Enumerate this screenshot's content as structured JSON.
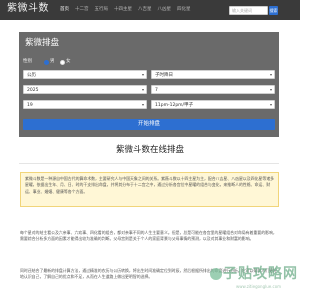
{
  "navbar": {
    "brand": "紫微斗数",
    "links": [
      "首页",
      "十二宫",
      "五行局",
      "十四主星",
      "八吉星",
      "八凶星",
      "四化星"
    ],
    "search_placeholder": "输入关键词",
    "search_button": "搜索"
  },
  "form": {
    "title": "紫微排盘",
    "gender_label": "性别",
    "gender_options": [
      "男",
      "女"
    ],
    "gender_selected": "男",
    "calendar_value": "公历",
    "shichen_value": "子时降日",
    "year_value": "2025",
    "month_value": "7",
    "day_value": "19",
    "hour_value": "11pm-12pm/甲子",
    "submit_label": "开始排盘"
  },
  "article": {
    "heading": "紫微斗数在线排盘",
    "intro": "紫微斗数是一种源自中国古代的算命术数，主要研究人与中国天象之间的关系。紫薇斗数以十四主星为主，配合八吉星、八凶星以及四化星等诸多星曜，依据出生年、月、日、时的干支排出命盘，并将其分布于十二宫之中，通过分析各宫位中星曜的组合与变化，来推断人的性格、命运、财运、事业、婚姻、健康等各个方面。",
    "paragraph1": "每个星对的结主看公及六亲事、六欢事、四化看的组合，都对亲事不同的人生主要意义。但是，总是可能在各宫里的星曜组合对命局有着重要的影响，需要综合分析多方面的因素才能得出较为准确的判断。父母宫则是关于个人的家庭背景与父母事情的预测，以及对其事业和财富的影响。",
    "paragraph2": "同时还结合了最新的排盘计算方法，通过精准的农历与公历转换，将出生时间准确定位到时辰，然后根据所排出的命盘进行分析。它可以帮助人们更好地认识自己，了解自己的优点和不足，从而在人生道路上做出更明智的选择。"
  },
  "watermark": {
    "text": "子贴攻略网",
    "sub": "www.zitiegonglue.com"
  }
}
